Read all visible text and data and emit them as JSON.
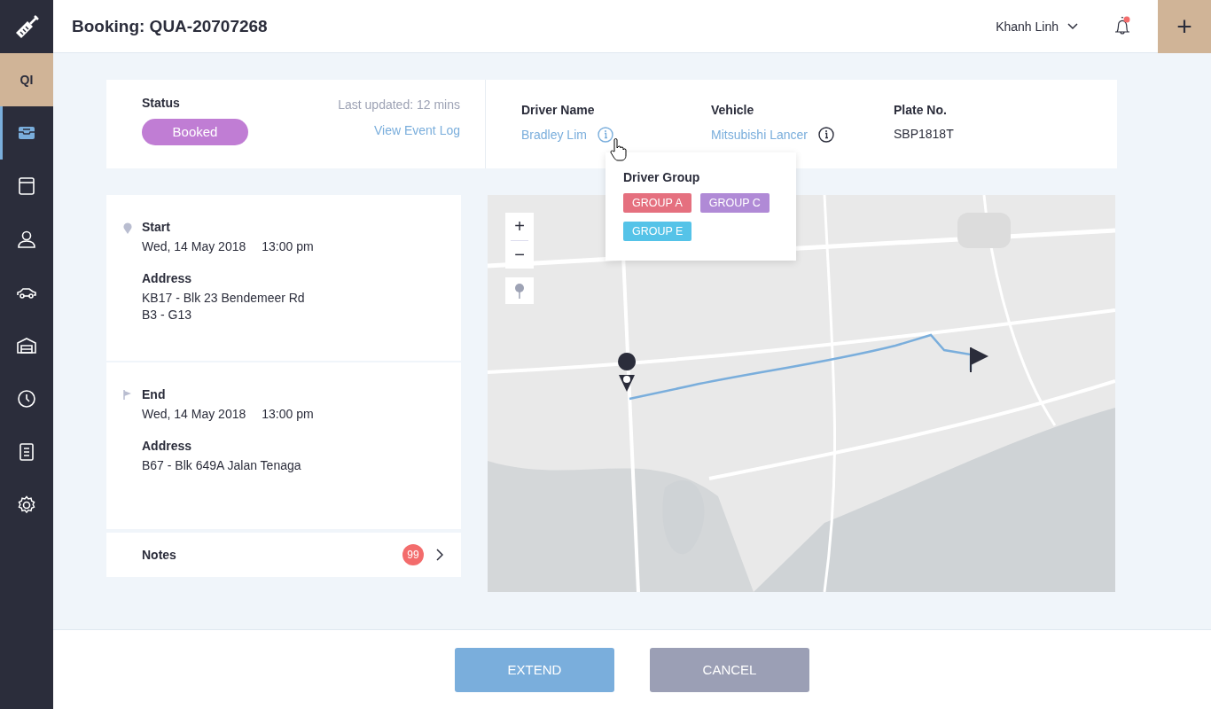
{
  "app": {
    "workspace": "QI"
  },
  "sidebar": {
    "items": [
      {
        "selected": true
      },
      {
        "selected": false
      },
      {
        "selected": false
      },
      {
        "selected": false
      },
      {
        "selected": false
      },
      {
        "selected": false
      },
      {
        "selected": false
      },
      {
        "selected": false
      }
    ]
  },
  "header": {
    "title": "Booking: QUA-20707268",
    "user": "Khanh Linh",
    "notification": true,
    "add": "+"
  },
  "status": {
    "label": "Status",
    "value": "Booked",
    "updated": "Last updated: 12 mins",
    "link": "View Event Log"
  },
  "fields": [
    {
      "label": "Driver Name",
      "value": "Bradley Lim",
      "info": true,
      "kind": "link"
    },
    {
      "label": "Vehicle",
      "value": "Mitsubishi Lancer",
      "info": true,
      "kind": "link"
    },
    {
      "label": "Plate No.",
      "value": "SBP1818T",
      "kind": "text"
    }
  ],
  "popup": {
    "title": "Driver Group",
    "tags": [
      {
        "label": "GROUP A",
        "color": "#e5707f"
      },
      {
        "label": "GROUP C",
        "color": "#b08ad6"
      },
      {
        "label": "GROUP E",
        "color": "#55c3e8"
      }
    ]
  },
  "stops": [
    {
      "kind": "start",
      "label": "Start",
      "date": "Wed, 14 May 2018",
      "time": "13:00 pm",
      "address_label": "Address",
      "address": [
        "KB17 - Blk 23 Bendemeer Rd",
        "B3 - G13"
      ]
    },
    {
      "kind": "end",
      "label": "End",
      "date": "Wed, 14 May 2018",
      "time": "13:00 pm",
      "address_label": "Address",
      "address": [
        "B67 - Blk 649A Jalan Tenaga"
      ]
    }
  ],
  "notes": {
    "label": "Notes",
    "count": "99"
  },
  "map": {
    "zoom_in": "+",
    "zoom_out": "−"
  },
  "buttons": [
    {
      "label": "EXTEND",
      "kind": "primary"
    },
    {
      "label": "CANCEL",
      "kind": "secondary"
    }
  ]
}
